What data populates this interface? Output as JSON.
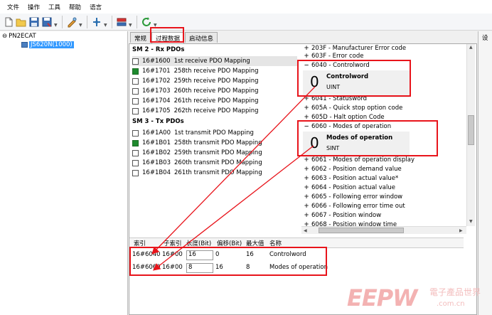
{
  "menu": [
    "文件",
    "操作",
    "工具",
    "帮助",
    "语言"
  ],
  "tree": {
    "root": "PN2ECAT",
    "root_prefix": "⊖",
    "child": "JS620N(1000)"
  },
  "tabs": [
    {
      "label": "常规",
      "active": false
    },
    {
      "label": "过程数据",
      "active": true
    },
    {
      "label": "启动信息",
      "active": false
    }
  ],
  "rx": {
    "title": "SM 2 - Rx PDOs",
    "items": [
      {
        "id": "16#1600",
        "name": "1st receive PDO Mapping",
        "checked": false,
        "selected": true
      },
      {
        "id": "16#1701",
        "name": "258th receive PDO Mapping",
        "checked": true,
        "selected": false
      },
      {
        "id": "16#1702",
        "name": "259th receive PDO Mapping",
        "checked": false,
        "selected": false
      },
      {
        "id": "16#1703",
        "name": "260th receive PDO Mapping",
        "checked": false,
        "selected": false
      },
      {
        "id": "16#1704",
        "name": "261th receive PDO Mapping",
        "checked": false,
        "selected": false
      },
      {
        "id": "16#1705",
        "name": "262th receive PDO Mapping",
        "checked": false,
        "selected": false
      }
    ]
  },
  "tx": {
    "title": "SM 3 - Tx PDOs",
    "items": [
      {
        "id": "16#1A00",
        "name": "1st transmit PDO Mapping",
        "checked": false
      },
      {
        "id": "16#1B01",
        "name": "258th transmit PDO Mapping",
        "checked": true
      },
      {
        "id": "16#1B02",
        "name": "259th transmit PDO Mapping",
        "checked": false
      },
      {
        "id": "16#1B03",
        "name": "260th transmit PDO Mapping",
        "checked": false
      },
      {
        "id": "16#1B04",
        "name": "261th transmit PDO Mapping",
        "checked": false
      }
    ]
  },
  "od": {
    "rows": [
      {
        "sign": "+",
        "text": "203F - Manufacturer Error code"
      },
      {
        "sign": "+",
        "text": "603F - Error code"
      },
      {
        "sign": "−",
        "text": "6040 - Controlword"
      },
      {
        "sign": "+",
        "text": "6041 - Statusword"
      },
      {
        "sign": "+",
        "text": "605A - Quick stop option code"
      },
      {
        "sign": "+",
        "text": "605D - Halt option Code"
      },
      {
        "sign": "−",
        "text": "6060 - Modes of operation"
      },
      {
        "sign": "+",
        "text": "6061 - Modes of operation display"
      },
      {
        "sign": "+",
        "text": "6062 - Position demand value"
      },
      {
        "sign": "+",
        "text": "6063 - Position actual value*"
      },
      {
        "sign": "+",
        "text": "6064 - Position actual value"
      },
      {
        "sign": "+",
        "text": "6065 - Following error window"
      },
      {
        "sign": "+",
        "text": "6066 - Following error time out"
      },
      {
        "sign": "+",
        "text": "6067 - Position window"
      },
      {
        "sign": "+",
        "text": "6068 - Position window time"
      }
    ],
    "detail1": {
      "value": "0",
      "name": "Controlword",
      "type": "UINT"
    },
    "detail2": {
      "value": "0",
      "name": "Modes of operation",
      "type": "SINT"
    }
  },
  "mapping": {
    "headers": [
      "索引",
      "子索引",
      "长度(Bit)",
      "偏移(Bit)",
      "最大值",
      "名称"
    ],
    "rows": [
      {
        "index": "16#6040",
        "subindex": "16#00",
        "length": "16",
        "offset": "0",
        "max": "16",
        "name": "Controlword"
      },
      {
        "index": "16#6060",
        "subindex": "16#00",
        "length": "8",
        "offset": "16",
        "max": "8",
        "name": "Modes of operation"
      }
    ]
  },
  "right_pane": {
    "label": "设"
  },
  "watermark": {
    "brand": "EEPW",
    "cn": "電子產品世界",
    "url": ".com.cn"
  },
  "colors": {
    "annotation": "#e8141b",
    "checked": "#1e8a2e",
    "selection": "#3399ff"
  }
}
